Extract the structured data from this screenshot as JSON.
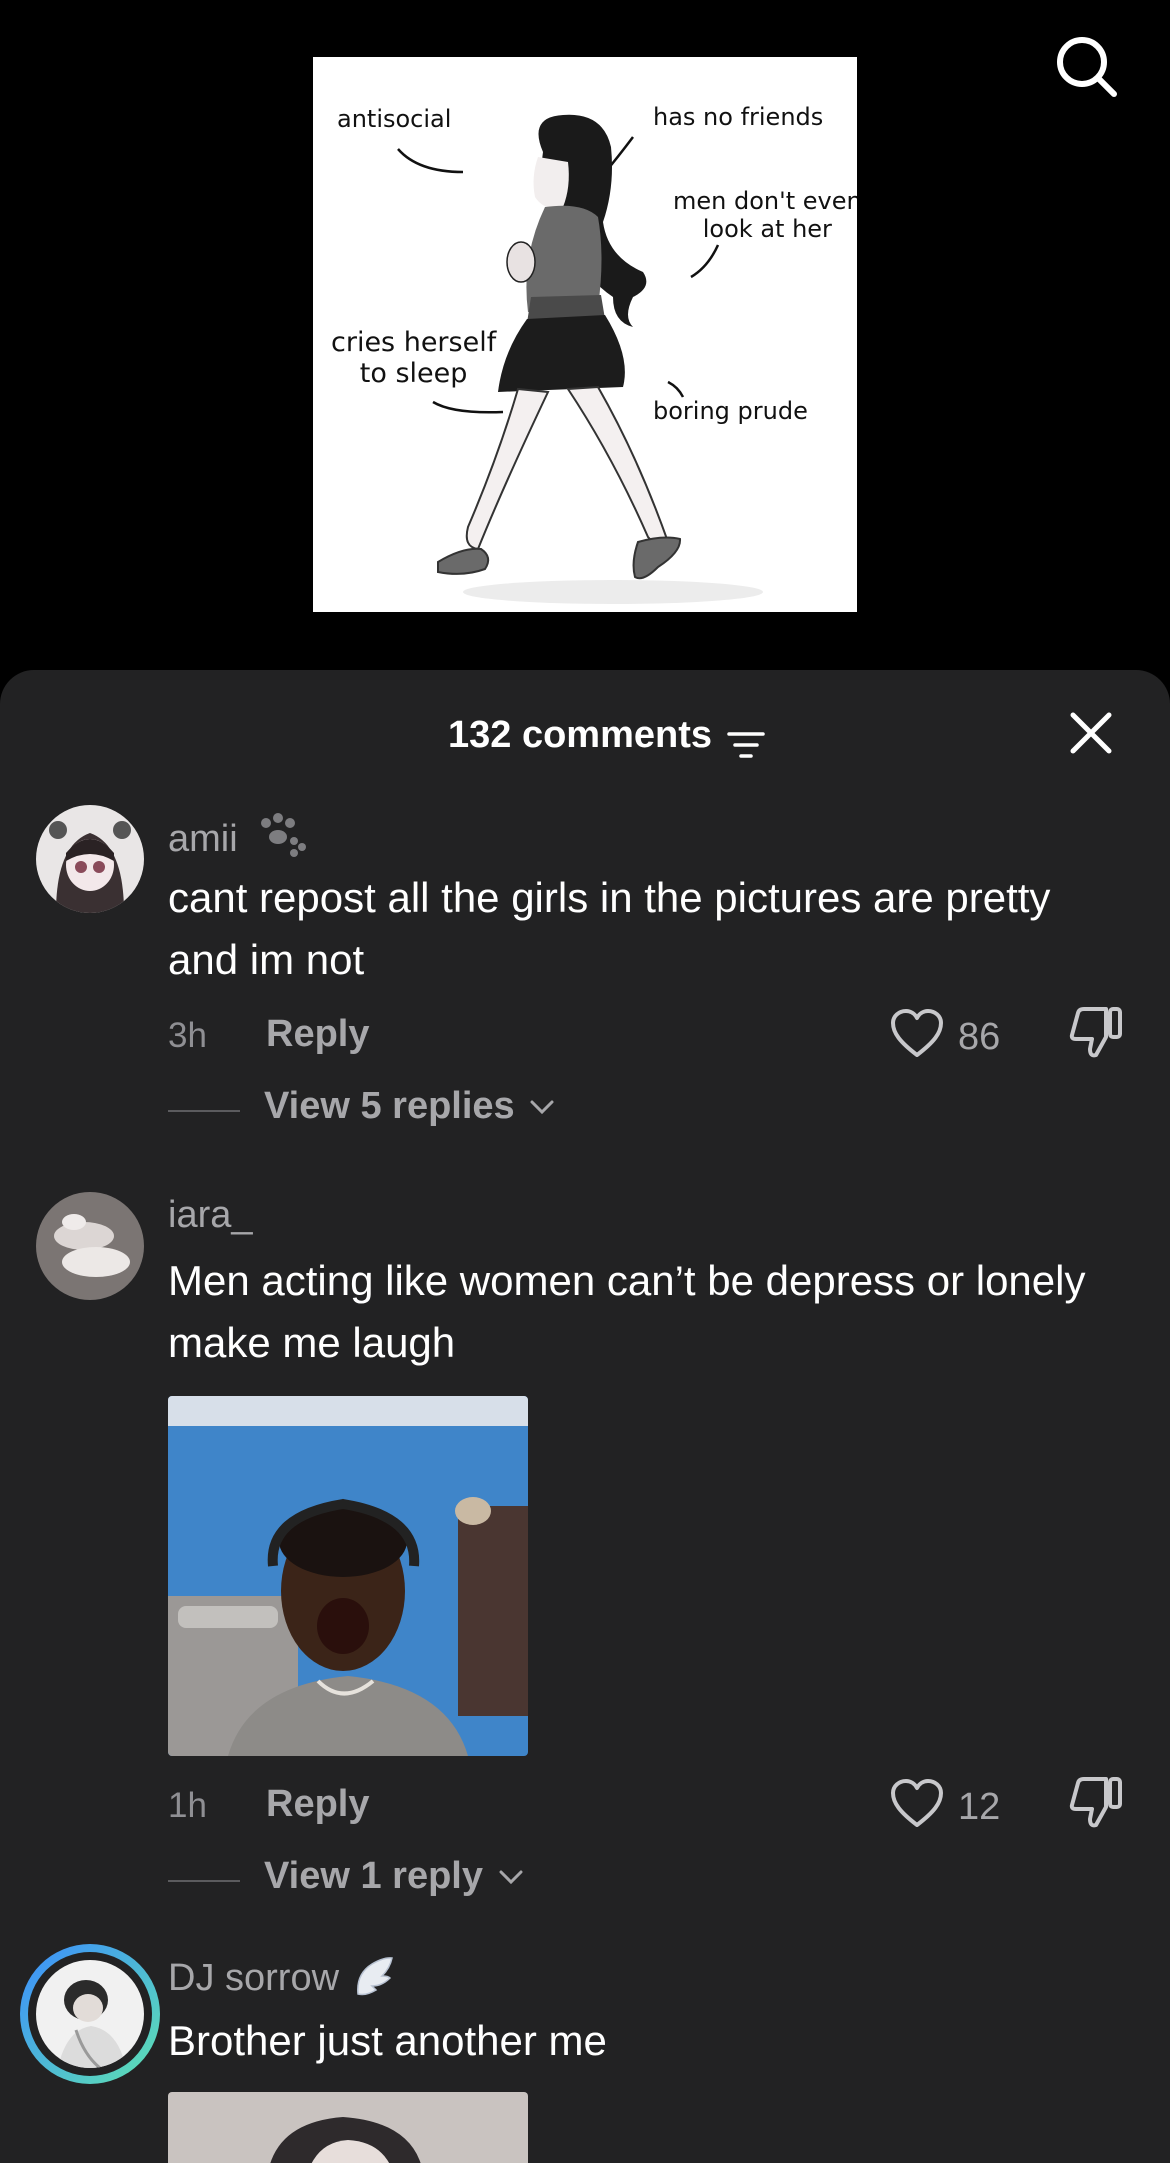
{
  "meme": {
    "labels": {
      "antisocial": "antisocial",
      "no_friends": "has no friends",
      "men_dont_look": "men don't even\nlook at her",
      "cries": "cries herself\nto sleep",
      "prude": "boring prude"
    }
  },
  "icons": {
    "search": "search-icon",
    "sort": "sort-icon",
    "close": "close-icon",
    "heart": "heart-icon",
    "dislike": "thumbs-down-icon",
    "chevron": "chevron-down-icon",
    "paw": "paw-icon",
    "wing": "wing-icon"
  },
  "sheet": {
    "comment_count": "132 comments"
  },
  "comments": [
    {
      "username": "amii",
      "text": "cant repost all the girls in the pictures are pretty and im not",
      "time": "3h",
      "reply_label": "Reply",
      "likes": "86",
      "view_replies": "View 5 replies"
    },
    {
      "username": "iara_",
      "text": "Men acting like women can’t be depress or lonely make me laugh",
      "time": "1h",
      "reply_label": "Reply",
      "likes": "12",
      "view_replies": "View 1 reply"
    },
    {
      "username": "DJ sorrow",
      "text": "Brother just another me"
    }
  ],
  "colors": {
    "sheet_bg": "#222223",
    "muted_text": "#a7a7aa",
    "story_ring_start": "#3b8cff",
    "story_ring_end": "#5fe3b0"
  }
}
